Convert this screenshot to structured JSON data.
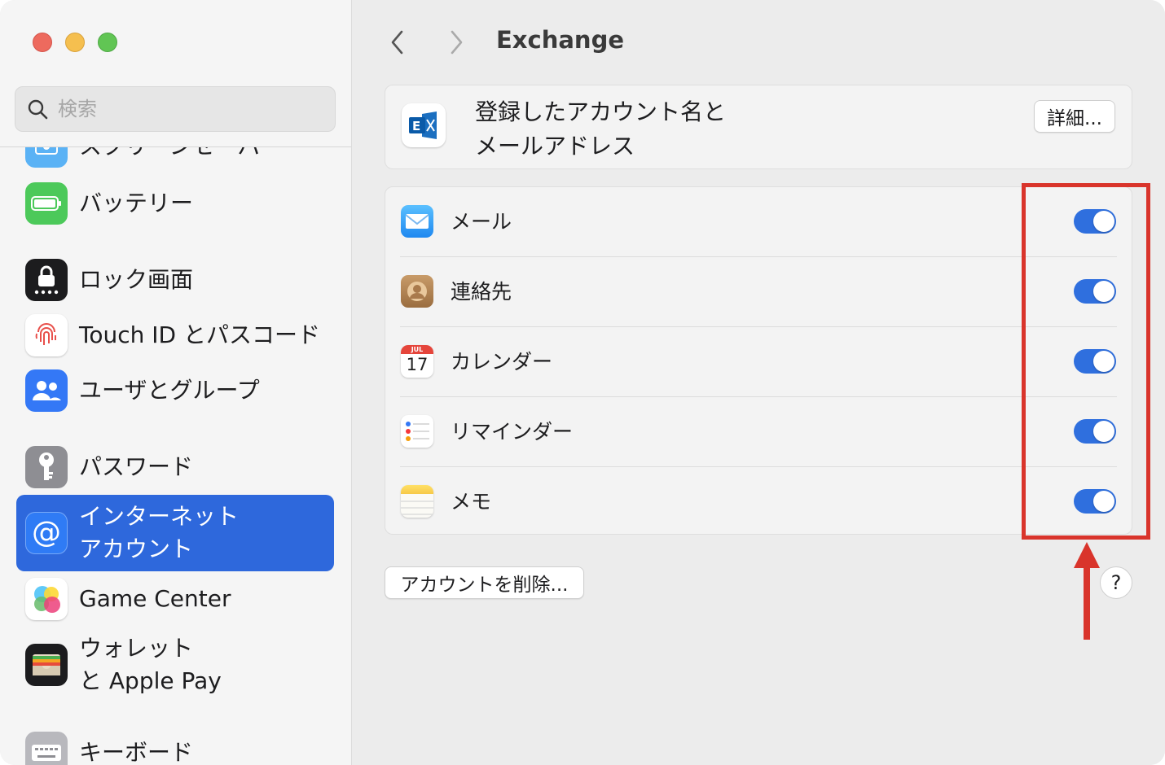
{
  "window": {
    "traffic_lights": [
      "close",
      "minimize",
      "zoom"
    ]
  },
  "sidebar": {
    "search": {
      "placeholder": "検索",
      "value": ""
    },
    "items": [
      {
        "label": "スクリーンセーバ",
        "icon": "screensaver-icon",
        "color": "#5ab2f5",
        "active": false
      },
      {
        "label": "バッテリー",
        "icon": "battery-icon",
        "color": "#4cc95a",
        "active": false
      },
      {
        "label": "ロック画面",
        "icon": "lock-icon",
        "color": "#1c1c1e",
        "active": false
      },
      {
        "label": "Touch ID とパスコード",
        "icon": "fingerprint-icon",
        "color": "#ffffff",
        "active": false
      },
      {
        "label": "ユーザとグループ",
        "icon": "users-icon",
        "color": "#3478f6",
        "active": false
      },
      {
        "label": "パスワード",
        "icon": "key-icon",
        "color": "#8e8e93",
        "active": false
      },
      {
        "label": "インターネット\nアカウント",
        "icon": "at-sign-icon",
        "color": "#2f7bf5",
        "active": true
      },
      {
        "label": "Game Center",
        "icon": "game-center-icon",
        "color": "#ffffff",
        "active": false
      },
      {
        "label": "ウォレット\nと Apple Pay",
        "icon": "wallet-icon",
        "color": "#1c1c1e",
        "active": false
      },
      {
        "label": "キーボード",
        "icon": "keyboard-icon",
        "color": "#b8b8bd",
        "active": false
      }
    ]
  },
  "header": {
    "title": "Exchange",
    "back_icon": "chevron-left-icon",
    "forward_icon": "chevron-right-icon"
  },
  "account": {
    "icon": "exchange-icon",
    "name": "登録したアカウント名と\nメールアドレス",
    "details_label": "詳細..."
  },
  "services": [
    {
      "label": "メール",
      "icon": "mail-icon",
      "enabled": true
    },
    {
      "label": "連絡先",
      "icon": "contacts-icon",
      "enabled": true
    },
    {
      "label": "カレンダー",
      "icon": "calendar-icon",
      "enabled": true,
      "icon_text_month": "JUL",
      "icon_text_day": "17"
    },
    {
      "label": "リマインダー",
      "icon": "reminders-icon",
      "enabled": true
    },
    {
      "label": "メモ",
      "icon": "notes-icon",
      "enabled": true
    }
  ],
  "footer": {
    "delete_label": "アカウントを削除...",
    "help_label": "?"
  },
  "colors": {
    "accent": "#2f6fde",
    "sidebar_selected": "#2e68dc",
    "annotation": "#d9342b"
  }
}
